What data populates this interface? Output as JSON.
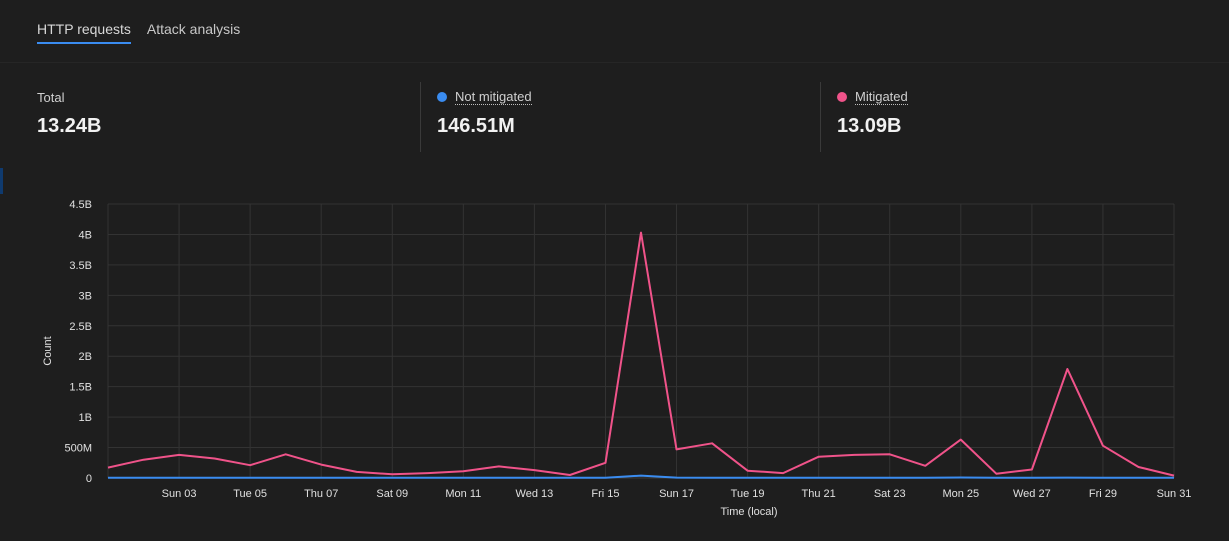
{
  "tabs": [
    {
      "label": "HTTP requests",
      "active": true
    },
    {
      "label": "Attack analysis",
      "active": false
    }
  ],
  "stats": {
    "total": {
      "label": "Total",
      "value": "13.24B"
    },
    "not_mitigated": {
      "label": "Not mitigated",
      "value": "146.51M",
      "color": "#3a8cf0"
    },
    "mitigated": {
      "label": "Mitigated",
      "value": "13.09B",
      "color": "#f0538a"
    }
  },
  "chart_data": {
    "type": "line",
    "xlabel": "Time (local)",
    "ylabel": "Count",
    "ylim": [
      0,
      4.5
    ],
    "y_unit": "B",
    "y_ticks": [
      "0",
      "500M",
      "1B",
      "1.5B",
      "2B",
      "2.5B",
      "3B",
      "3.5B",
      "4B",
      "4.5B"
    ],
    "x_tick_labels": [
      "Sun 03",
      "Tue 05",
      "Thu 07",
      "Sat 09",
      "Mon 11",
      "Wed 13",
      "Fri 15",
      "Sun 17",
      "Tue 19",
      "Thu 21",
      "Sat 23",
      "Mon 25",
      "Wed 27",
      "Fri 29",
      "Sun 31"
    ],
    "grid": true,
    "series": [
      {
        "name": "Mitigated",
        "color": "#f0538a",
        "values": [
          0.17,
          0.3,
          0.38,
          0.32,
          0.21,
          0.39,
          0.22,
          0.1,
          0.06,
          0.08,
          0.11,
          0.19,
          0.13,
          0.05,
          0.25,
          4.03,
          0.47,
          0.57,
          0.12,
          0.08,
          0.35,
          0.38,
          0.39,
          0.2,
          0.63,
          0.07,
          0.14,
          1.79,
          0.53,
          0.18,
          0.04
        ]
      },
      {
        "name": "Not mitigated",
        "color": "#3a8cf0",
        "values": [
          0.005,
          0.005,
          0.005,
          0.005,
          0.005,
          0.005,
          0.005,
          0.004,
          0.004,
          0.004,
          0.004,
          0.004,
          0.004,
          0.004,
          0.005,
          0.04,
          0.006,
          0.005,
          0.005,
          0.005,
          0.005,
          0.005,
          0.005,
          0.005,
          0.008,
          0.005,
          0.005,
          0.007,
          0.005,
          0.005,
          0.005
        ]
      }
    ]
  }
}
